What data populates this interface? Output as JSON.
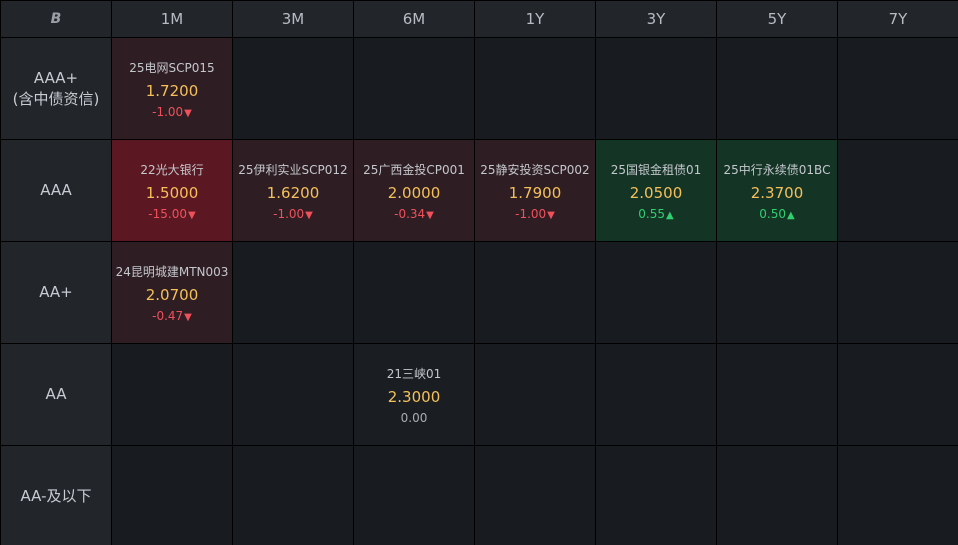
{
  "header": {
    "corner_icon": "brand-logo-icon",
    "corner_text": "B",
    "columns": [
      "1M",
      "3M",
      "6M",
      "1Y",
      "3Y",
      "5Y",
      "7Y"
    ]
  },
  "rows": [
    {
      "label_line1": "AAA+",
      "label_line2": "(含中债资信)"
    },
    {
      "label_line1": "AAA",
      "label_line2": ""
    },
    {
      "label_line1": "AA+",
      "label_line2": ""
    },
    {
      "label_line1": "AA",
      "label_line2": ""
    },
    {
      "label_line1": "AA-及以下",
      "label_line2": ""
    }
  ],
  "colors": {
    "yield": "#f5c05a",
    "negative": "#f0505a",
    "positive": "#2fcf6e",
    "strong_negative_bg": "#5b1823",
    "negative_bg": "#2e1e23",
    "positive_bg": "#143426"
  },
  "cells": {
    "r0c0": {
      "name": "25电网SCP015",
      "yield": "1.7200",
      "change": "-1.00",
      "arrow": "▼"
    },
    "r1c0": {
      "name": "22光大银行",
      "yield": "1.5000",
      "change": "-15.00",
      "arrow": "▼"
    },
    "r1c1": {
      "name": "25伊利实业SCP012",
      "yield": "1.6200",
      "change": "-1.00",
      "arrow": "▼"
    },
    "r1c2": {
      "name": "25广西金投CP001",
      "yield": "2.0000",
      "change": "-0.34",
      "arrow": "▼"
    },
    "r1c3": {
      "name": "25静安投资SCP002",
      "yield": "1.7900",
      "change": "-1.00",
      "arrow": "▼"
    },
    "r1c4": {
      "name": "25国银金租债01",
      "yield": "2.0500",
      "change": "0.55",
      "arrow": "▲"
    },
    "r1c5": {
      "name": "25中行永续债01BC",
      "yield": "2.3700",
      "change": "0.50",
      "arrow": "▲"
    },
    "r2c0": {
      "name": "24昆明城建MTN003",
      "yield": "2.0700",
      "change": "-0.47",
      "arrow": "▼"
    },
    "r3c2": {
      "name": "21三峡01",
      "yield": "2.3000",
      "change": "0.00",
      "arrow": ""
    }
  }
}
